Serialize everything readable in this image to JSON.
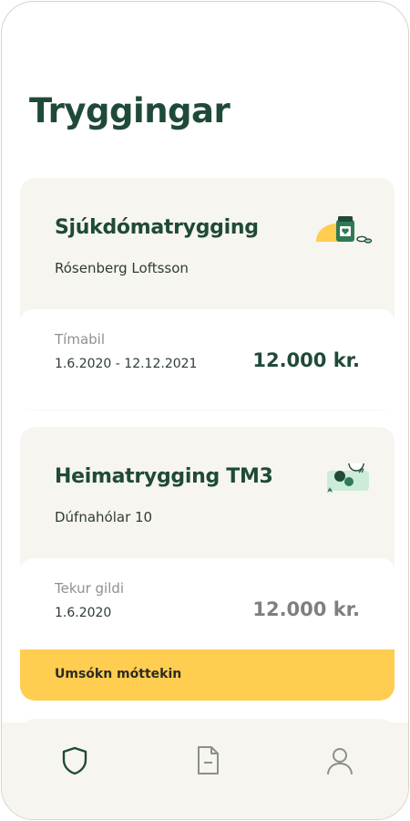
{
  "page": {
    "title": "Tryggingar"
  },
  "policies": [
    {
      "name": "Sjúkdómatrygging",
      "holder": "Rósenberg Loftsson",
      "icon": "medicine-bottle-icon",
      "label": "Tímabil",
      "date": "1.6.2020 - 12.12.2021",
      "price": "12.000 kr."
    },
    {
      "name": "Heimatrygging TM3",
      "holder": "Dúfnahólar 10",
      "icon": "home-items-icon",
      "label": "Tekur gildi",
      "date": "1.6.2020",
      "price": "12.000 kr.",
      "status": "Umsókn móttekin"
    }
  ],
  "nav": {
    "items": [
      {
        "icon": "shield-icon",
        "active": true
      },
      {
        "icon": "document-icon",
        "active": false
      },
      {
        "icon": "user-icon",
        "active": false
      }
    ]
  },
  "colors": {
    "brand_green": "#1f4a38",
    "card_bg": "#f7f5f0",
    "status_yellow": "#ffcd50",
    "muted_text": "#8d918e"
  }
}
